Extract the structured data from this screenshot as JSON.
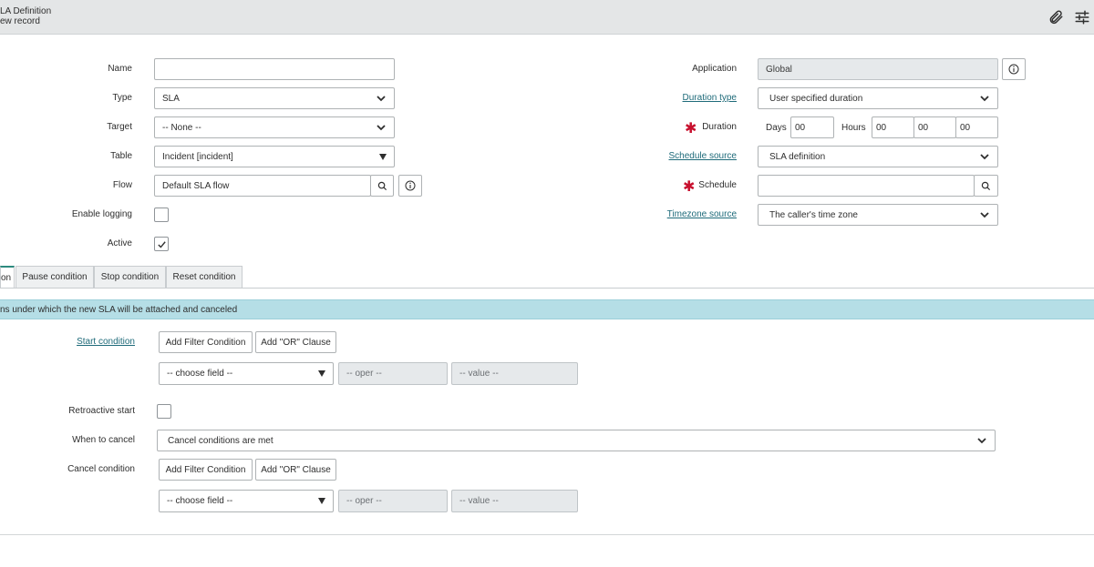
{
  "header": {
    "title": "LA Definition",
    "subtitle": "ew record"
  },
  "form": {
    "name": {
      "label": "Name",
      "value": ""
    },
    "type": {
      "label": "Type",
      "value": "SLA"
    },
    "target": {
      "label": "Target",
      "value": "-- None --"
    },
    "table": {
      "label": "Table",
      "value": "Incident [incident]"
    },
    "flow": {
      "label": "Flow",
      "value": "Default SLA flow"
    },
    "enable_logging": {
      "label": "Enable logging",
      "checked": false
    },
    "active": {
      "label": "Active",
      "checked": true
    },
    "application": {
      "label": "Application",
      "value": "Global"
    },
    "duration_type": {
      "label": "Duration type",
      "value": "User specified duration"
    },
    "duration": {
      "label": "Duration",
      "days_label": "Days",
      "days": "00",
      "hours_label": "Hours",
      "hours": "00",
      "minutes": "00",
      "seconds": "00"
    },
    "schedule_source": {
      "label": "Schedule source",
      "value": "SLA definition"
    },
    "schedule": {
      "label": "Schedule",
      "value": ""
    },
    "timezone_source": {
      "label": "Timezone source",
      "value": "The caller's time zone"
    }
  },
  "tabs": [
    {
      "label": "on",
      "active": true
    },
    {
      "label": "Pause condition",
      "active": false
    },
    {
      "label": "Stop condition",
      "active": false
    },
    {
      "label": "Reset condition",
      "active": false
    }
  ],
  "start_section": {
    "banner": "ns under which the new SLA will be attached and canceled",
    "start_condition_label": "Start condition",
    "add_filter_label": "Add Filter Condition",
    "add_or_label": "Add \"OR\" Clause",
    "choose_field": "-- choose field --",
    "oper": "-- oper --",
    "value": "-- value --",
    "retroactive_label": "Retroactive start",
    "retroactive_checked": false,
    "when_to_cancel_label": "When to cancel",
    "when_to_cancel_value": "Cancel conditions are met",
    "cancel_condition_label": "Cancel condition",
    "cancel_add_filter_label": "Add Filter Condition",
    "cancel_add_or_label": "Add \"OR\" Clause",
    "cancel_choose_field": "-- choose field --",
    "cancel_oper": "-- oper --",
    "cancel_value": "-- value --"
  },
  "colors": {
    "accent": "#2d8a7e",
    "banner": "#b5dee6",
    "required": "#c8102e",
    "link": "#1f6b7a"
  }
}
